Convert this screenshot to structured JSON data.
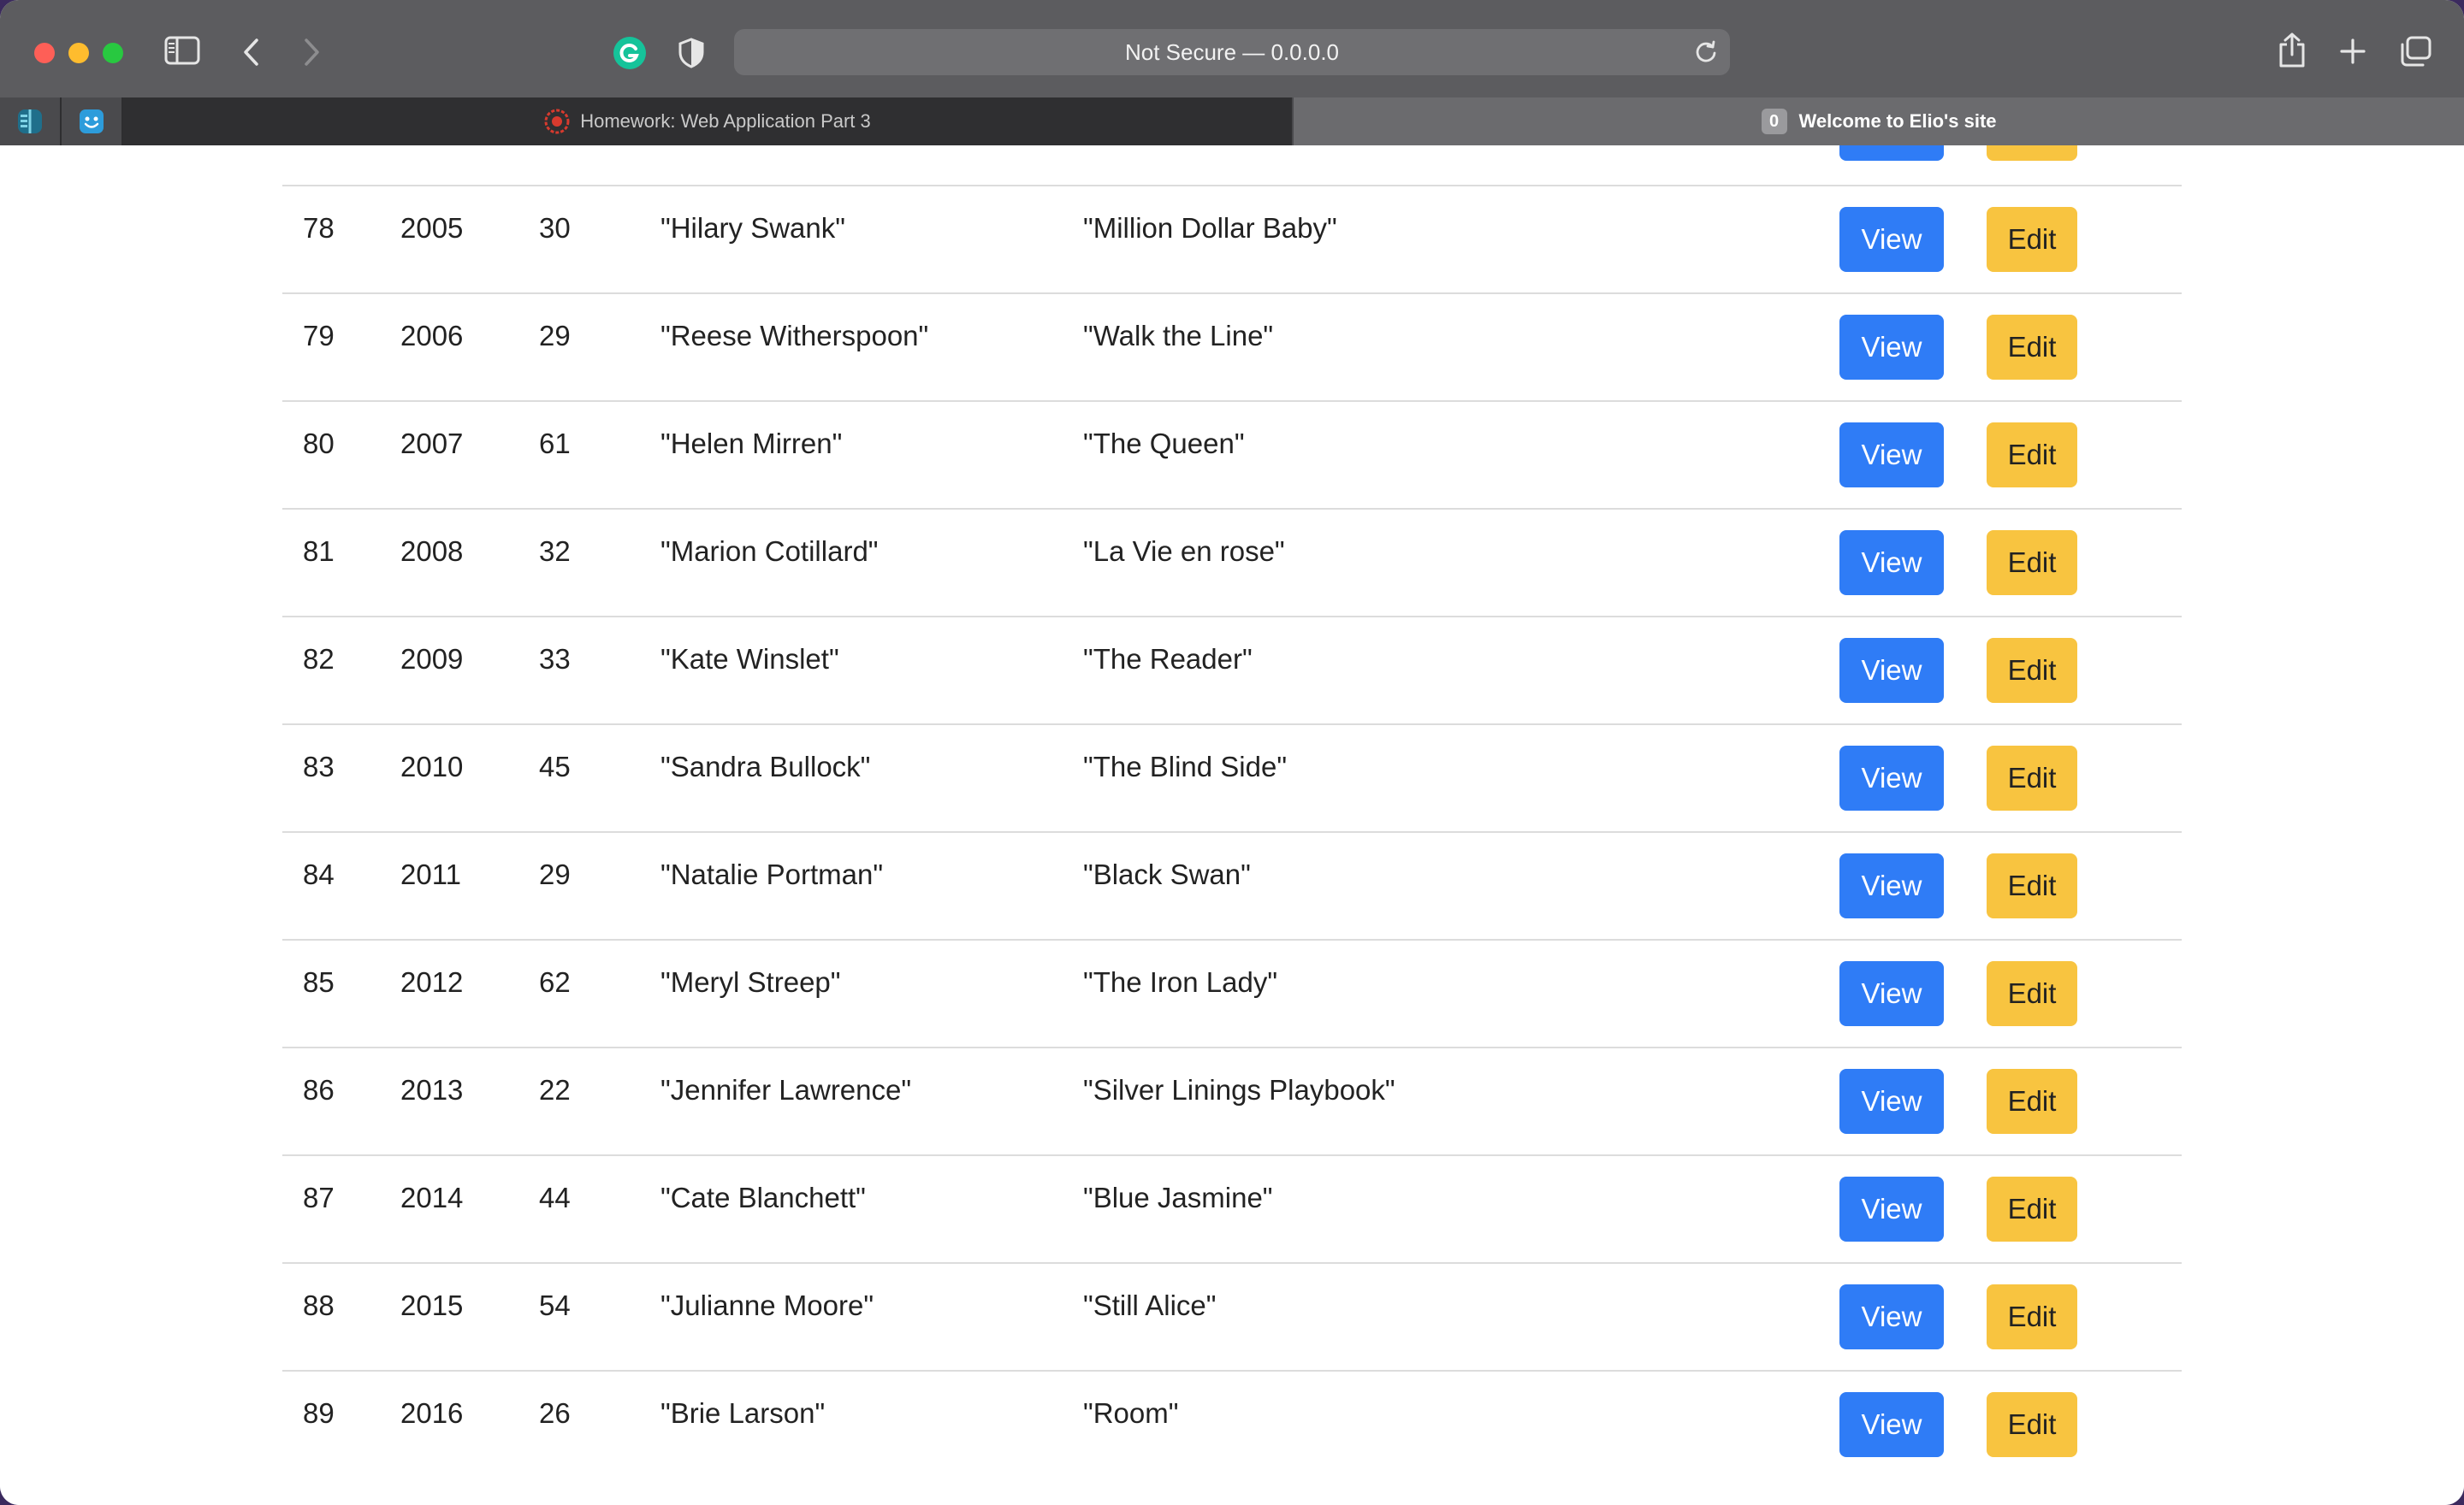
{
  "browser": {
    "url_text": "Not Secure — 0.0.0.0",
    "tabs": [
      {
        "title": "Homework: Web Application Part 3",
        "active": false
      },
      {
        "title": "Welcome to Elio's site",
        "badge": "0",
        "active": true
      }
    ]
  },
  "table": {
    "view_label": "View",
    "edit_label": "Edit",
    "rows": [
      {
        "id": "78",
        "year": "2005",
        "age": "30",
        "name": "\"Hilary Swank\"",
        "movie": "\"Million Dollar Baby\""
      },
      {
        "id": "79",
        "year": "2006",
        "age": "29",
        "name": "\"Reese Witherspoon\"",
        "movie": "\"Walk the Line\""
      },
      {
        "id": "80",
        "year": "2007",
        "age": "61",
        "name": "\"Helen Mirren\"",
        "movie": "\"The Queen\""
      },
      {
        "id": "81",
        "year": "2008",
        "age": "32",
        "name": "\"Marion Cotillard\"",
        "movie": "\"La Vie en rose\""
      },
      {
        "id": "82",
        "year": "2009",
        "age": "33",
        "name": "\"Kate Winslet\"",
        "movie": "\"The Reader\""
      },
      {
        "id": "83",
        "year": "2010",
        "age": "45",
        "name": "\"Sandra Bullock\"",
        "movie": "\"The Blind Side\""
      },
      {
        "id": "84",
        "year": "2011",
        "age": "29",
        "name": "\"Natalie Portman\"",
        "movie": "\"Black Swan\""
      },
      {
        "id": "85",
        "year": "2012",
        "age": "62",
        "name": "\"Meryl Streep\"",
        "movie": "\"The Iron Lady\""
      },
      {
        "id": "86",
        "year": "2013",
        "age": "22",
        "name": "\"Jennifer Lawrence\"",
        "movie": "\"Silver Linings Playbook\""
      },
      {
        "id": "87",
        "year": "2014",
        "age": "44",
        "name": "\"Cate Blanchett\"",
        "movie": "\"Blue Jasmine\""
      },
      {
        "id": "88",
        "year": "2015",
        "age": "54",
        "name": "\"Julianne Moore\"",
        "movie": "\"Still Alice\""
      },
      {
        "id": "89",
        "year": "2016",
        "age": "26",
        "name": "\"Brie Larson\"",
        "movie": "\"Room\""
      }
    ]
  },
  "colors": {
    "view_button": "#2f7cf6",
    "edit_button": "#f8c440"
  },
  "icons": [
    "sidebar-icon",
    "back-icon",
    "forward-icon",
    "grammarly-icon",
    "privacy-shield-icon",
    "reload-icon",
    "share-icon",
    "new-tab-icon",
    "tab-overview-icon"
  ]
}
